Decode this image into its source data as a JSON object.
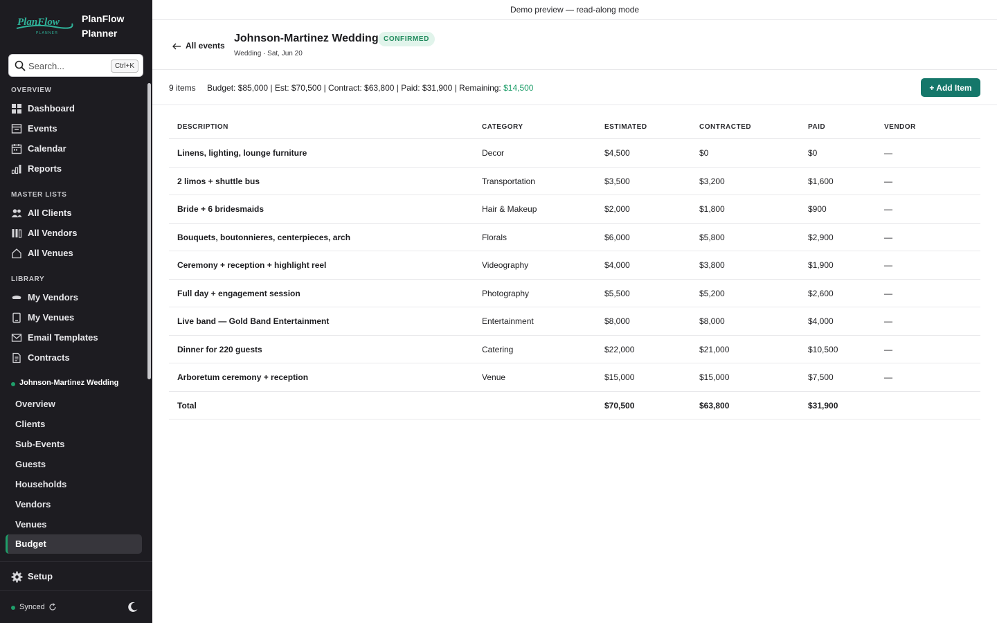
{
  "app": {
    "name": "PlanFlow Planner",
    "logo_text": "PlanFlow",
    "logo_subtext": "PLANNER"
  },
  "search": {
    "placeholder": "Search...",
    "shortcut": "Ctrl+K"
  },
  "sidebar": {
    "sections": [
      {
        "label": "OVERVIEW",
        "items": [
          {
            "label": "Dashboard",
            "icon": "dashboard-icon"
          },
          {
            "label": "Events",
            "icon": "events-icon"
          },
          {
            "label": "Calendar",
            "icon": "calendar-icon"
          },
          {
            "label": "Reports",
            "icon": "reports-icon"
          }
        ]
      },
      {
        "label": "MASTER LISTS",
        "items": [
          {
            "label": "All Clients",
            "icon": "clients-icon"
          },
          {
            "label": "All Vendors",
            "icon": "vendors-icon"
          },
          {
            "label": "All Venues",
            "icon": "venues-icon"
          }
        ]
      },
      {
        "label": "LIBRARY",
        "items": [
          {
            "label": "My Vendors",
            "icon": "my-vendors-icon"
          },
          {
            "label": "My Venues",
            "icon": "my-venues-icon"
          },
          {
            "label": "Email Templates",
            "icon": "email-icon"
          },
          {
            "label": "Contracts",
            "icon": "contracts-icon"
          }
        ]
      }
    ],
    "event": {
      "title": "Johnson-Martinez Wedding",
      "items": [
        "Overview",
        "Clients",
        "Sub-Events",
        "Guests",
        "Households",
        "Vendors",
        "Venues",
        "Budget"
      ],
      "active": "Budget"
    },
    "setup_label": "Setup",
    "sync_status": "Synced"
  },
  "topbar": {
    "demo_text": "Demo preview — read-along mode"
  },
  "header": {
    "back_label": "All events",
    "event_name": "Johnson-Martinez Wedding",
    "status": "CONFIRMED",
    "subtitle": "Wedding · Sat, Jun 20"
  },
  "summary": {
    "count": "9 items",
    "text": "Budget: $85,000 | Est: $70,500 | Contract: $63,800 | Paid: $31,900 | Remaining: ",
    "remaining": "$14,500",
    "add_label": "+ Add Item"
  },
  "table": {
    "columns": [
      "DESCRIPTION",
      "CATEGORY",
      "ESTIMATED",
      "CONTRACTED",
      "PAID",
      "VENDOR"
    ],
    "rows": [
      {
        "description": "Linens, lighting, lounge furniture",
        "category": "Decor",
        "estimated": "$4,500",
        "contracted": "$0",
        "paid": "$0",
        "vendor": "—"
      },
      {
        "description": "2 limos + shuttle bus",
        "category": "Transportation",
        "estimated": "$3,500",
        "contracted": "$3,200",
        "paid": "$1,600",
        "vendor": "—"
      },
      {
        "description": "Bride + 6 bridesmaids",
        "category": "Hair & Makeup",
        "estimated": "$2,000",
        "contracted": "$1,800",
        "paid": "$900",
        "vendor": "—"
      },
      {
        "description": "Bouquets, boutonnieres, centerpieces, arch",
        "category": "Florals",
        "estimated": "$6,000",
        "contracted": "$5,800",
        "paid": "$2,900",
        "vendor": "—"
      },
      {
        "description": "Ceremony + reception + highlight reel",
        "category": "Videography",
        "estimated": "$4,000",
        "contracted": "$3,800",
        "paid": "$1,900",
        "vendor": "—"
      },
      {
        "description": "Full day + engagement session",
        "category": "Photography",
        "estimated": "$5,500",
        "contracted": "$5,200",
        "paid": "$2,600",
        "vendor": "—"
      },
      {
        "description": "Live band — Gold Band Entertainment",
        "category": "Entertainment",
        "estimated": "$8,000",
        "contracted": "$8,000",
        "paid": "$4,000",
        "vendor": "—"
      },
      {
        "description": "Dinner for 220 guests",
        "category": "Catering",
        "estimated": "$22,000",
        "contracted": "$21,000",
        "paid": "$10,500",
        "vendor": "—"
      },
      {
        "description": "Arboretum ceremony + reception",
        "category": "Venue",
        "estimated": "$15,000",
        "contracted": "$15,000",
        "paid": "$7,500",
        "vendor": "—"
      }
    ],
    "total": {
      "label": "Total",
      "estimated": "$70,500",
      "contracted": "$63,800",
      "paid": "$31,900"
    }
  },
  "colors": {
    "sidebar_bg": "#1d1c21",
    "accent": "#1f9e6a",
    "button": "#15776a",
    "badge_bg": "#e1f4eb",
    "badge_text": "#1f8a5c"
  }
}
